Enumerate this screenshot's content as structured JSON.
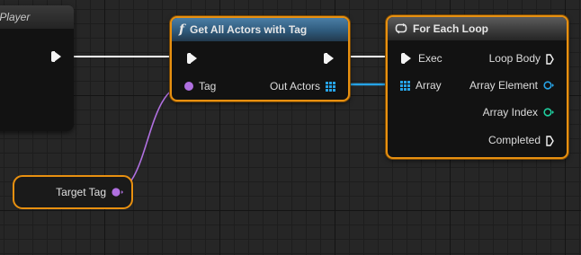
{
  "nodes": {
    "event": {
      "title": "est Player"
    },
    "get_all_actors": {
      "title": "Get All Actors with Tag",
      "icon": "function-icon",
      "pins": {
        "tag": "Tag",
        "out_actors": "Out Actors"
      }
    },
    "for_each": {
      "title": "For Each Loop",
      "icon": "loop-icon",
      "pins": {
        "exec": "Exec",
        "array": "Array",
        "loop_body": "Loop Body",
        "array_element": "Array Element",
        "array_index": "Array Index",
        "completed": "Completed"
      }
    },
    "target_tag": {
      "label": "Target Tag"
    }
  },
  "colors": {
    "selection": "#e89010",
    "exec_wire": "#ffffff",
    "name_wire": "#b070e0",
    "array_wire": "#27a3e6",
    "object_pin": "#27a3e6",
    "int_pin": "#1fd0a0"
  }
}
